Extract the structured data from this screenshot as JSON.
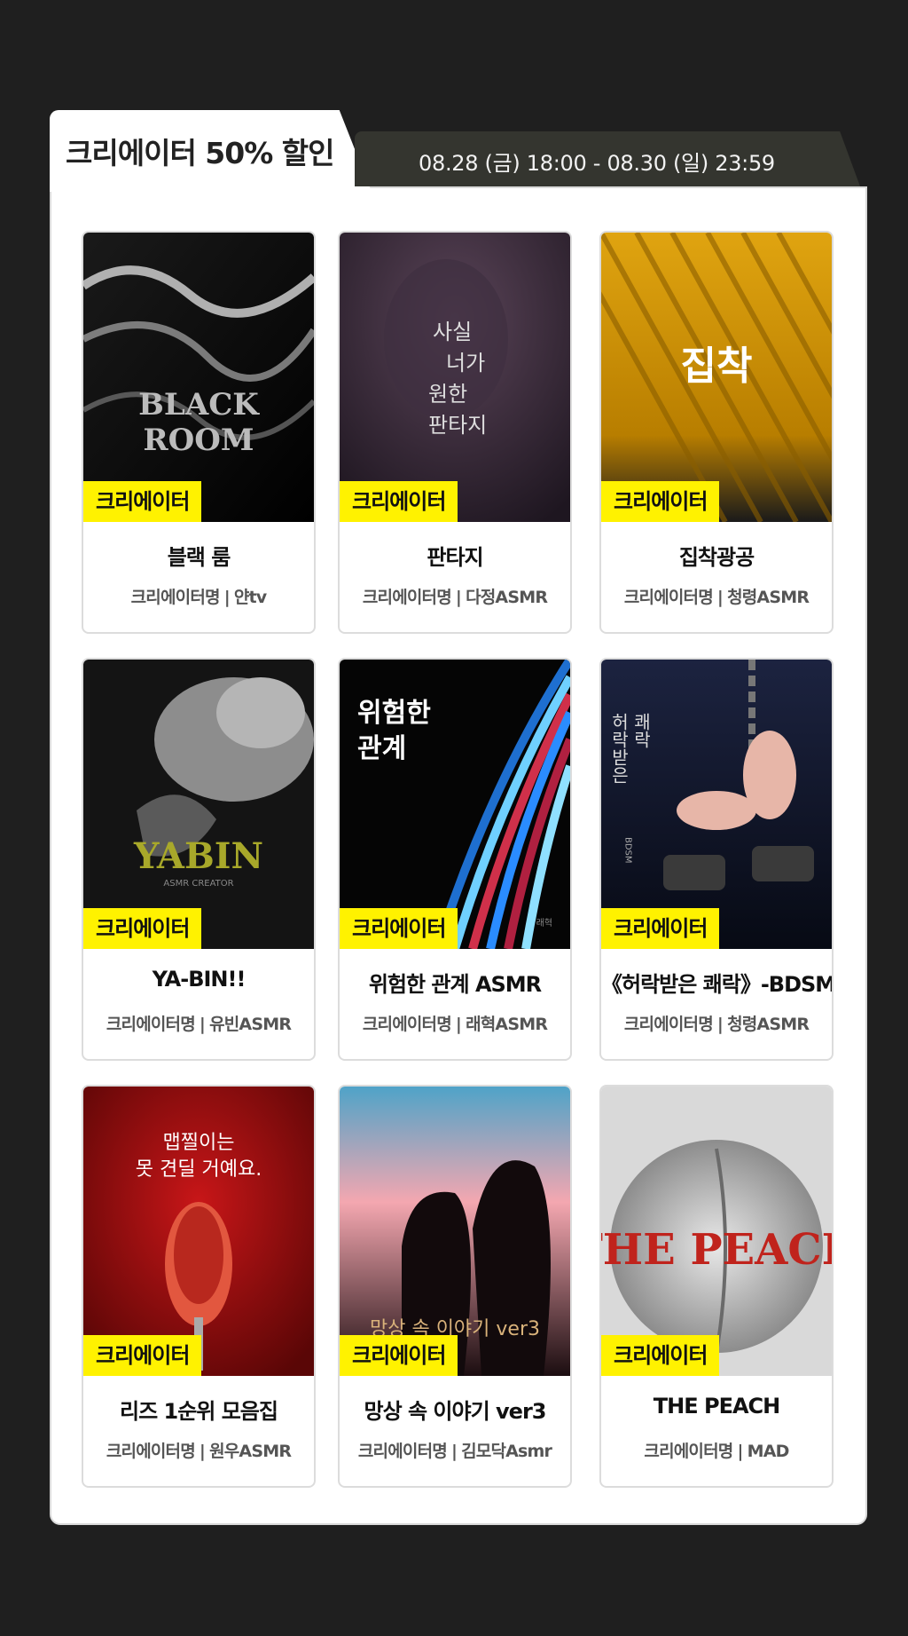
{
  "header": {
    "title": "크리에이터 50% 할인",
    "period": "08.28 (금) 18:00 - 08.30 (일) 23:59"
  },
  "badge_label": "크리에이터",
  "creator_label": "크리에이터명",
  "separator": "|",
  "cards": [
    {
      "title": "블랙 룸",
      "creator": "얀tv",
      "cover_text": [
        "BLACK",
        "ROOM"
      ]
    },
    {
      "title": "판타지",
      "creator": "다정ASMR",
      "cover_text": [
        "사실",
        "너가",
        "원한",
        "판타지"
      ]
    },
    {
      "title": "집착광공",
      "creator": "청령ASMR",
      "cover_text": [
        "집착"
      ]
    },
    {
      "title": "YA-BIN!!",
      "creator": "유빈ASMR",
      "cover_text": [
        "YABIN",
        "ASMR CREATOR"
      ]
    },
    {
      "title": "위험한 관계 ASMR",
      "creator": "래혁ASMR",
      "cover_text": [
        "위험한",
        "관계",
        "래혁"
      ]
    },
    {
      "title": "《허락받은 쾌락》-BDSM-",
      "creator": "청령ASMR",
      "cover_text": [
        "허락받은",
        "쾌락",
        "BDSM"
      ]
    },
    {
      "title": "리즈 1순위 모음집",
      "creator": "원우ASMR",
      "cover_text": [
        "맵찔이는",
        "못 견딜 거예요."
      ]
    },
    {
      "title": "망상 속 이야기 ver3",
      "creator": "김모닥Asmr",
      "cover_text": [
        "망상 속 이야기 ver3"
      ]
    },
    {
      "title": "THE PEACH",
      "creator": "MAD",
      "cover_text": [
        "THE PEACH"
      ]
    }
  ],
  "colors": {
    "background": "#1f1f1f",
    "badge": "#fff200",
    "date_tab": "#34352f"
  }
}
